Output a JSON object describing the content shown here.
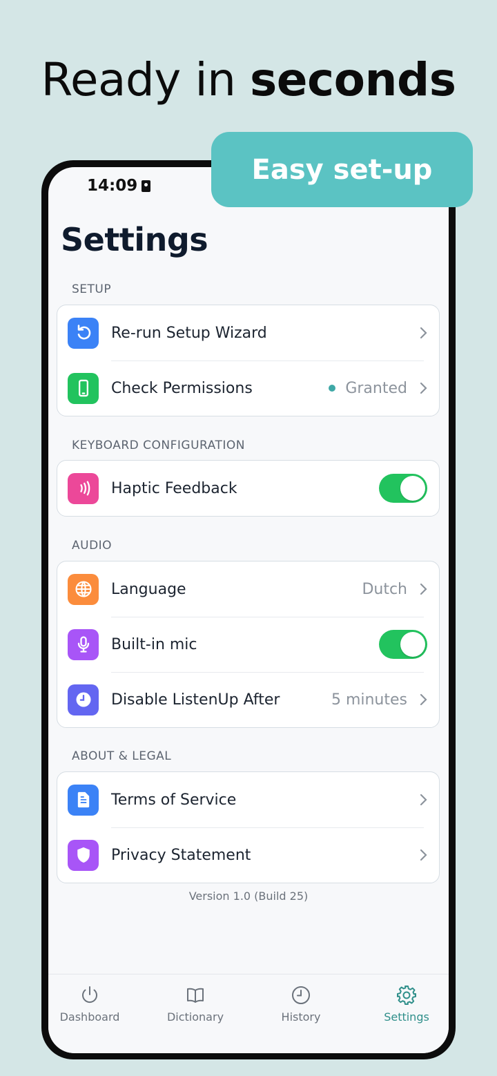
{
  "headline": {
    "regular": "Ready in ",
    "bold": "seconds"
  },
  "promo_pill": "Easy set-up",
  "status_bar": {
    "time": "14:09"
  },
  "page_title": "Settings",
  "sections": {
    "setup": {
      "label": "SETUP",
      "rerun": {
        "label": "Re-run Setup Wizard",
        "icon": "refresh-icon",
        "color": "#3b82f6"
      },
      "permissions": {
        "label": "Check Permissions",
        "value": "Granted",
        "icon": "phone-icon",
        "color": "#22c35e"
      }
    },
    "keyboard": {
      "label": "KEYBOARD CONFIGURATION",
      "haptic": {
        "label": "Haptic Feedback",
        "enabled": true,
        "icon": "vibration-icon",
        "color": "#ec4899"
      }
    },
    "audio": {
      "label": "AUDIO",
      "language": {
        "label": "Language",
        "value": "Dutch",
        "icon": "globe-icon",
        "color": "#fb8c3c"
      },
      "mic": {
        "label": "Built-in mic",
        "enabled": true,
        "icon": "microphone-icon",
        "color": "#a855f7"
      },
      "disable": {
        "label": "Disable ListenUp After",
        "value": "5 minutes",
        "icon": "clock-icon",
        "color": "#6366f1"
      }
    },
    "about": {
      "label": "ABOUT & LEGAL",
      "terms": {
        "label": "Terms of Service",
        "icon": "document-icon",
        "color": "#3b82f6"
      },
      "privacy": {
        "label": "Privacy Statement",
        "icon": "shield-icon",
        "color": "#a855f7"
      }
    }
  },
  "version": "Version 1.0 (Build 25)",
  "tabs": [
    {
      "label": "Dashboard",
      "icon": "power-icon"
    },
    {
      "label": "Dictionary",
      "icon": "book-icon"
    },
    {
      "label": "History",
      "icon": "clock-icon"
    },
    {
      "label": "Settings",
      "icon": "gear-icon",
      "active": true
    }
  ],
  "colors": {
    "background": "#d4e6e6",
    "accent": "#5bc3c3",
    "toggle_on": "#22c35e",
    "active_tab": "#2f8f8a"
  }
}
